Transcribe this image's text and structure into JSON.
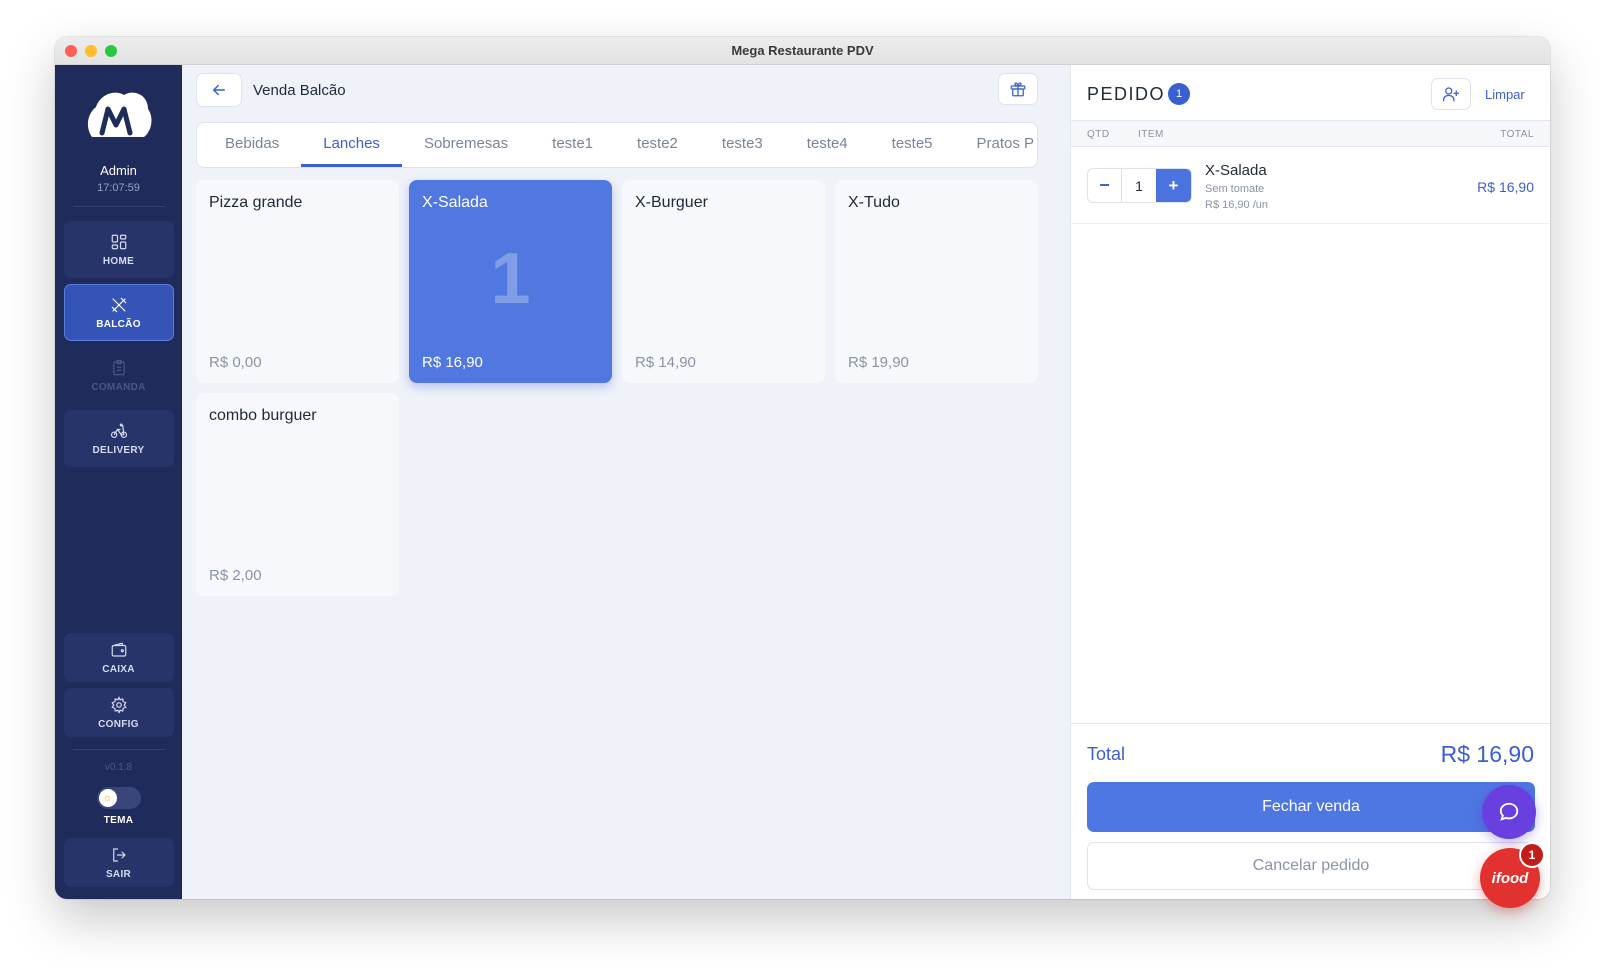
{
  "window": {
    "title": "Mega Restaurante PDV"
  },
  "sidebar": {
    "user": "Admin",
    "time": "17:07:59",
    "nav": [
      {
        "label": "HOME",
        "icon": "grid-icon"
      },
      {
        "label": "BALCÃO",
        "icon": "utensils-crossed-icon"
      },
      {
        "label": "COMANDA",
        "icon": "clipboard-icon"
      },
      {
        "label": "DELIVERY",
        "icon": "bike-icon"
      }
    ],
    "bottom": [
      {
        "label": "CAIXA",
        "icon": "wallet-icon"
      },
      {
        "label": "CONFIG",
        "icon": "gear-icon"
      }
    ],
    "version": "v0.1.8",
    "theme_label": "TEMA",
    "exit_label": "SAIR"
  },
  "center": {
    "title": "Venda Balcão",
    "tabs": [
      "Bebidas",
      "Lanches",
      "Sobremesas",
      "teste1",
      "teste2",
      "teste3",
      "teste4",
      "teste5",
      "Pratos P"
    ],
    "active_tab": "Lanches",
    "products": [
      {
        "name": "Pizza grande",
        "price": "R$ 0,00"
      },
      {
        "name": "X-Salada",
        "price": "R$ 16,90",
        "qty": "1"
      },
      {
        "name": "X-Burguer",
        "price": "R$ 14,90"
      },
      {
        "name": "X-Tudo",
        "price": "R$ 19,90"
      },
      {
        "name": "combo burguer",
        "price": "R$ 2,00"
      }
    ]
  },
  "order": {
    "title": "PEDIDO",
    "count": "1",
    "clear_label": "Limpar",
    "columns": {
      "qty": "QTD",
      "item": "ITEM",
      "total": "TOTAL"
    },
    "items": [
      {
        "name": "X-Salada",
        "note": "Sem tomate",
        "unit": "R$ 16,90 /un",
        "qty": "1",
        "total": "R$ 16,90"
      }
    ],
    "total_label": "Total",
    "total_value": "R$ 16,90",
    "close_label": "Fechar venda",
    "cancel_label": "Cancelar pedido"
  },
  "ifood": {
    "label": "ifood",
    "badge": "1"
  },
  "colors": {
    "accent": "#3a5fd0",
    "sidebar": "#1f2b5b",
    "selected_card": "#5078e0"
  }
}
